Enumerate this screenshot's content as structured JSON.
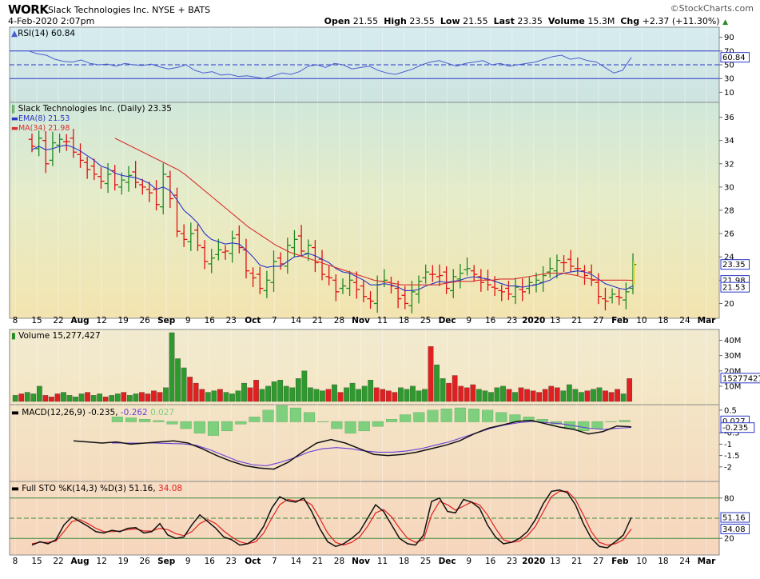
{
  "header": {
    "symbol": "WORK",
    "name": "Slack Technologies Inc.  NYSE + BATS",
    "date": "4-Feb-2020 2:07pm",
    "brand": "©StockCharts.com",
    "open_label": "Open",
    "open": "21.55",
    "high_label": "High",
    "high": "23.55",
    "low_label": "Low",
    "low": "21.55",
    "last_label": "Last",
    "last": "23.35",
    "volume_label": "Volume",
    "volume": "15.3M",
    "chg_label": "Chg",
    "chg": "+2.37 (+11.30%)",
    "up_arrow": "▲"
  },
  "colors": {
    "up": "#1f8a1f",
    "down": "#e01010",
    "ema": "#2a36c8",
    "ma": "#d83030",
    "rsi": "#4a5ed0",
    "macd": "#111111",
    "signal": "#6a3fd8",
    "hist": "#7ed07e",
    "sto_k": "#111111",
    "sto_d": "#e02020",
    "line_green": "#3a8a3a"
  },
  "legends": {
    "rsi": "RSI(14) 60.84",
    "price": "Slack Technologies Inc. (Daily) 23.35",
    "ema": "EMA(8) 21.53",
    "ma": "MA(34) 21.98",
    "volume": "Volume 15,277,427",
    "macd_main": "MACD(12,26,9) -0.235,",
    "macd_sig": "-0.262",
    "macd_hist": "0.027",
    "sto_main": "Full STO %K(14,3) %D(3) 51.16,",
    "sto_d": "34.08"
  },
  "x_axis_labels": [
    "8",
    "15",
    "22",
    "Aug",
    "12",
    "19",
    "26",
    "Sep",
    "9",
    "16",
    "23",
    "Oct",
    "7",
    "14",
    "21",
    "28",
    "Nov",
    "11",
    "18",
    "25",
    "Dec",
    "9",
    "16",
    "23",
    "2020",
    "13",
    "21",
    "27",
    "Feb",
    "10",
    "18",
    "24",
    "Mar"
  ],
  "chart_data": [
    {
      "type": "line",
      "name": "RSI",
      "title": "RSI(14) 60.84",
      "ylim": [
        0,
        100
      ],
      "yticks": [
        10,
        30,
        50,
        70,
        90
      ],
      "reference_lines": [
        70,
        50,
        30
      ],
      "last_value": "60.84",
      "values": [
        70,
        66,
        64,
        58,
        55,
        54,
        57,
        52,
        50,
        51,
        48,
        52,
        50,
        49,
        51,
        47,
        44,
        46,
        50,
        42,
        38,
        40,
        35,
        36,
        33,
        34,
        32,
        30,
        34,
        38,
        36,
        40,
        48,
        50,
        46,
        52,
        50,
        44,
        46,
        48,
        42,
        38,
        36,
        40,
        44,
        50,
        54,
        56,
        52,
        48,
        52,
        54,
        56,
        50,
        52,
        48,
        50,
        52,
        54,
        58,
        62,
        64,
        58,
        60,
        56,
        54,
        46,
        38,
        42,
        60.84
      ]
    },
    {
      "type": "candlestick",
      "name": "Price",
      "title": "Slack Technologies Inc. (Daily) 23.35",
      "ylim": [
        19,
        37
      ],
      "yticks": [
        20,
        22,
        24,
        26,
        28,
        30,
        32,
        34,
        36
      ],
      "last_value": "23.35",
      "ema_label": "21.53",
      "ma_label": "21.98",
      "close": [
        33.5,
        34.2,
        32.0,
        33.8,
        34.1,
        33.9,
        33.0,
        32.3,
        31.5,
        31.1,
        30.5,
        31.1,
        30.2,
        30.6,
        31.0,
        30.4,
        30.0,
        29.5,
        28.5,
        31.1,
        29.0,
        26.2,
        25.5,
        26.0,
        25.0,
        23.6,
        23.9,
        24.6,
        24.5,
        25.6,
        24.8,
        22.8,
        22.2,
        21.3,
        22.0,
        23.6,
        23.4,
        25.0,
        25.5,
        24.5,
        25.0,
        23.5,
        22.5,
        22.2,
        21.0,
        21.5,
        22.0,
        21.2,
        20.6,
        20.2,
        21.6,
        22.0,
        21.5,
        20.4,
        20.0,
        21.0,
        21.9,
        22.7,
        22.5,
        22.4,
        21.3,
        22.3,
        22.6,
        23.0,
        22.5,
        21.8,
        21.6,
        21.3,
        21.0,
        20.8,
        21.4,
        21.0,
        21.8,
        22.0,
        22.4,
        23.0,
        23.7,
        23.5,
        23.2,
        23.0,
        22.4,
        22.0,
        20.6,
        20.2,
        20.8,
        20.5,
        21.0,
        23.35
      ],
      "ema8": [
        33.2,
        33.5,
        33.2,
        33.3,
        33.5,
        33.6,
        33.4,
        33.1,
        32.7,
        32.3,
        31.8,
        31.6,
        31.2,
        31.0,
        30.9,
        30.8,
        30.6,
        30.3,
        29.8,
        30.0,
        29.7,
        28.9,
        28.0,
        27.5,
        26.9,
        26.0,
        25.5,
        25.3,
        25.1,
        25.2,
        25.1,
        24.6,
        24.0,
        23.3,
        23.1,
        23.2,
        23.2,
        23.6,
        24.0,
        24.1,
        24.3,
        24.1,
        23.8,
        23.5,
        23.0,
        22.7,
        22.6,
        22.3,
        22.0,
        21.6,
        21.6,
        21.7,
        21.6,
        21.4,
        21.1,
        21.1,
        21.2,
        21.5,
        21.7,
        21.9,
        21.8,
        21.9,
        22.0,
        22.2,
        22.3,
        22.2,
        22.1,
        21.9,
        21.7,
        21.5,
        21.5,
        21.4,
        21.5,
        21.6,
        21.8,
        22.0,
        22.4,
        22.6,
        22.7,
        22.8,
        22.7,
        22.5,
        22.1,
        21.7,
        21.5,
        21.3,
        21.2,
        21.53
      ],
      "ma34_start_index": 12,
      "ma34": [
        34.2,
        33.9,
        33.6,
        33.3,
        33.0,
        32.7,
        32.4,
        32.1,
        31.8,
        31.5,
        31.1,
        30.6,
        30.1,
        29.6,
        29.1,
        28.6,
        28.1,
        27.6,
        27.1,
        26.6,
        26.2,
        25.8,
        25.4,
        25.0,
        24.7,
        24.4,
        24.2,
        24.0,
        23.8,
        23.6,
        23.4,
        23.2,
        23.0,
        22.8,
        22.6,
        22.4,
        22.2,
        22.0,
        21.9,
        21.8,
        21.7,
        21.6,
        21.6,
        21.6,
        21.6,
        21.6,
        21.6,
        21.7,
        21.8,
        21.9,
        21.9,
        21.9,
        22.0,
        22.0,
        22.0,
        22.1,
        22.1,
        22.1,
        22.2,
        22.3,
        22.4,
        22.5,
        22.6,
        22.6,
        22.6,
        22.5,
        22.4,
        22.2,
        22.1,
        22.0,
        22.0,
        22.0,
        22.0,
        22.0,
        21.98
      ]
    },
    {
      "type": "bar",
      "name": "Volume",
      "title": "Volume 15,277,427",
      "ylim": [
        0,
        45
      ],
      "unit": "M",
      "yticks": [
        10,
        20,
        30,
        40
      ],
      "last_value": "15277427",
      "values": [
        4,
        5,
        6,
        5,
        10,
        4,
        3,
        5,
        6,
        4,
        3,
        5,
        6,
        4,
        5,
        3,
        4,
        5,
        6,
        4,
        5,
        6,
        5,
        7,
        6,
        9,
        45,
        28,
        22,
        16,
        12,
        8,
        6,
        7,
        8,
        6,
        5,
        7,
        12,
        9,
        14,
        8,
        10,
        13,
        14,
        10,
        9,
        15,
        20,
        9,
        8,
        7,
        8,
        11,
        6,
        9,
        12,
        8,
        10,
        14,
        9,
        8,
        7,
        6,
        9,
        8,
        10,
        7,
        8,
        36,
        24,
        15,
        12,
        17,
        10,
        9,
        11,
        8,
        7,
        6,
        9,
        10,
        8,
        6,
        9,
        8,
        7,
        6,
        8,
        10,
        9,
        7,
        11,
        8,
        6,
        7,
        8,
        9,
        7,
        6,
        8,
        5,
        15
      ]
    },
    {
      "type": "line",
      "name": "MACD",
      "title": "MACD(12,26,9) -0.235, -0.262 0.027",
      "ylim": [
        -2.5,
        0.6
      ],
      "yticks": [
        0.5,
        -0.5,
        -1.0,
        -1.5,
        -2.0
      ],
      "last_value": "-0.235",
      "signal_last": "-0.262",
      "hist_last": "0.027",
      "macd": [
        -0.85,
        -0.9,
        -0.95,
        -0.9,
        -1.0,
        -0.95,
        -0.9,
        -0.85,
        -0.95,
        -1.2,
        -1.5,
        -1.75,
        -1.95,
        -2.05,
        -2.1,
        -1.8,
        -1.35,
        -0.95,
        -0.8,
        -0.95,
        -1.2,
        -1.45,
        -1.5,
        -1.45,
        -1.35,
        -1.2,
        -1.05,
        -0.85,
        -0.55,
        -0.3,
        -0.15,
        0.0,
        0.05,
        -0.1,
        -0.25,
        -0.35,
        -0.55,
        -0.45,
        -0.2,
        -0.235
      ],
      "signal": [
        -0.95,
        -0.95,
        -0.95,
        -0.95,
        -0.97,
        -0.98,
        -1.05,
        -1.25,
        -1.5,
        -1.75,
        -1.9,
        -1.95,
        -1.8,
        -1.6,
        -1.35,
        -1.2,
        -1.15,
        -1.2,
        -1.3,
        -1.35,
        -1.35,
        -1.3,
        -1.2,
        -1.05,
        -0.9,
        -0.7,
        -0.5,
        -0.3,
        -0.15,
        -0.05,
        0.0,
        -0.05,
        -0.1,
        -0.2,
        -0.3,
        -0.35,
        -0.3,
        -0.262
      ],
      "histogram": [
        0.1,
        0.08,
        0.05,
        0.02,
        -0.05,
        -0.15,
        -0.25,
        -0.3,
        -0.2,
        -0.05,
        0.1,
        0.25,
        0.35,
        0.3,
        0.2,
        0.0,
        -0.15,
        -0.25,
        -0.2,
        -0.1,
        0.05,
        0.15,
        0.2,
        0.25,
        0.28,
        0.3,
        0.28,
        0.25,
        0.2,
        0.15,
        0.1,
        0.05,
        -0.05,
        -0.15,
        -0.2,
        -0.15,
        0.0,
        0.027
      ]
    },
    {
      "type": "line",
      "name": "Full STO",
      "title": "Full STO %K(14,3) %D(3) 51.16, 34.08",
      "ylim": [
        0,
        100
      ],
      "yticks": [
        20,
        80
      ],
      "reference_lines": [
        80,
        50,
        20
      ],
      "last_value": "51.16",
      "d_last": "34.08",
      "k": [
        10,
        15,
        12,
        18,
        40,
        52,
        45,
        38,
        30,
        28,
        32,
        30,
        35,
        36,
        28,
        30,
        42,
        25,
        20,
        22,
        40,
        55,
        45,
        35,
        22,
        18,
        10,
        12,
        20,
        38,
        65,
        82,
        76,
        74,
        80,
        60,
        35,
        15,
        8,
        12,
        20,
        30,
        50,
        70,
        60,
        40,
        20,
        12,
        10,
        25,
        75,
        80,
        60,
        58,
        78,
        74,
        65,
        40,
        22,
        12,
        14,
        20,
        30,
        48,
        72,
        90,
        92,
        88,
        70,
        42,
        20,
        8,
        6,
        15,
        25,
        51.16
      ],
      "d": [
        12,
        14,
        14,
        16,
        30,
        45,
        48,
        42,
        35,
        30,
        30,
        31,
        33,
        34,
        31,
        31,
        35,
        33,
        27,
        24,
        30,
        42,
        48,
        42,
        31,
        22,
        15,
        12,
        15,
        28,
        50,
        70,
        78,
        76,
        77,
        70,
        50,
        28,
        14,
        10,
        14,
        22,
        38,
        58,
        63,
        52,
        35,
        20,
        14,
        18,
        55,
        75,
        70,
        62,
        68,
        74,
        70,
        55,
        35,
        18,
        14,
        16,
        24,
        38,
        60,
        82,
        90,
        90,
        78,
        55,
        30,
        14,
        10,
        12,
        18,
        34.08
      ]
    }
  ]
}
